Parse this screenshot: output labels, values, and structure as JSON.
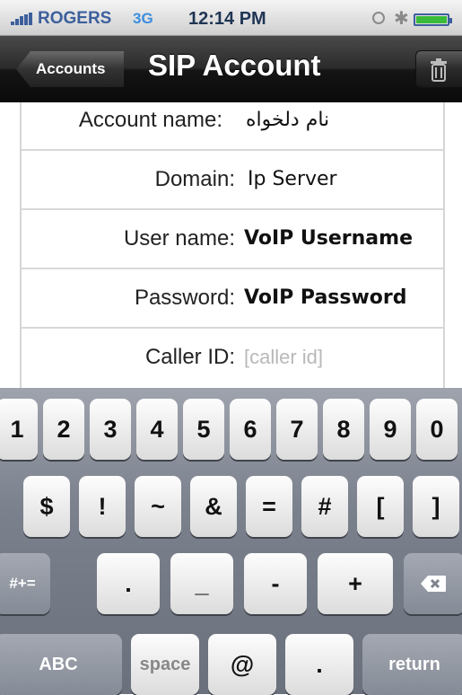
{
  "status_bar": {
    "carrier": "ROGERS",
    "network": "3G",
    "time": "12:14 PM",
    "icons": [
      "signal-bars-icon",
      "lock-rotation-icon",
      "bluetooth-icon",
      "battery-icon"
    ],
    "battery_color": "#3bbb3b"
  },
  "nav": {
    "back_label": "Accounts",
    "title": "SIP Account",
    "trash_icon": "trash-icon"
  },
  "form": {
    "account_name_label": "Account name:",
    "account_name_value": "نام دلخواه",
    "domain_label": "Domain:",
    "domain_value": "Ip Server",
    "username_label": "User name:",
    "username_value": "VoIP Username",
    "password_label": "Password:",
    "password_value": "VoIP Password",
    "caller_id_label": "Caller ID:",
    "caller_id_placeholder": "[caller id]"
  },
  "keyboard": {
    "row1": [
      "1",
      "2",
      "3",
      "4",
      "5",
      "6",
      "7",
      "8",
      "9",
      "0"
    ],
    "row2": [
      "$",
      "!",
      "~",
      "&",
      "=",
      "#",
      "[",
      "]"
    ],
    "row3": [
      "#+=",
      ".",
      "_",
      "-",
      "+"
    ],
    "row4": [
      "ABC",
      "space",
      "@",
      ".",
      "return"
    ],
    "delete_icon": "delete-backspace-icon"
  }
}
